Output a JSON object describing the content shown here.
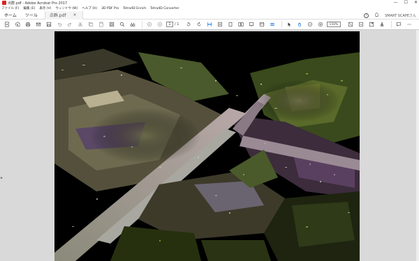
{
  "window": {
    "title": "点群.pdf - Adobe Acrobat Pro 2017",
    "min": "—",
    "max": "☐",
    "close": "✕"
  },
  "menu": {
    "items": [
      "ファイル (F)",
      "編集 (E)",
      "表示 (V)",
      "ウィンドウ (W)",
      "ヘルプ (H)",
      "3D PDF Pro",
      "Tetra4D Enrich",
      "Tetra4D Converter"
    ]
  },
  "tabs": {
    "home": "ホーム",
    "tools": "ツール",
    "document": "点群.pdf",
    "document_close": "×"
  },
  "account": {
    "help": "?",
    "bell": "🔔",
    "user": "SMART SCAPEさん"
  },
  "toolbar": {
    "current_page": "1",
    "page_count": "/ 1",
    "zoom": "150%"
  },
  "colors": {
    "accent": "#1473e6",
    "icon": "#444444"
  }
}
